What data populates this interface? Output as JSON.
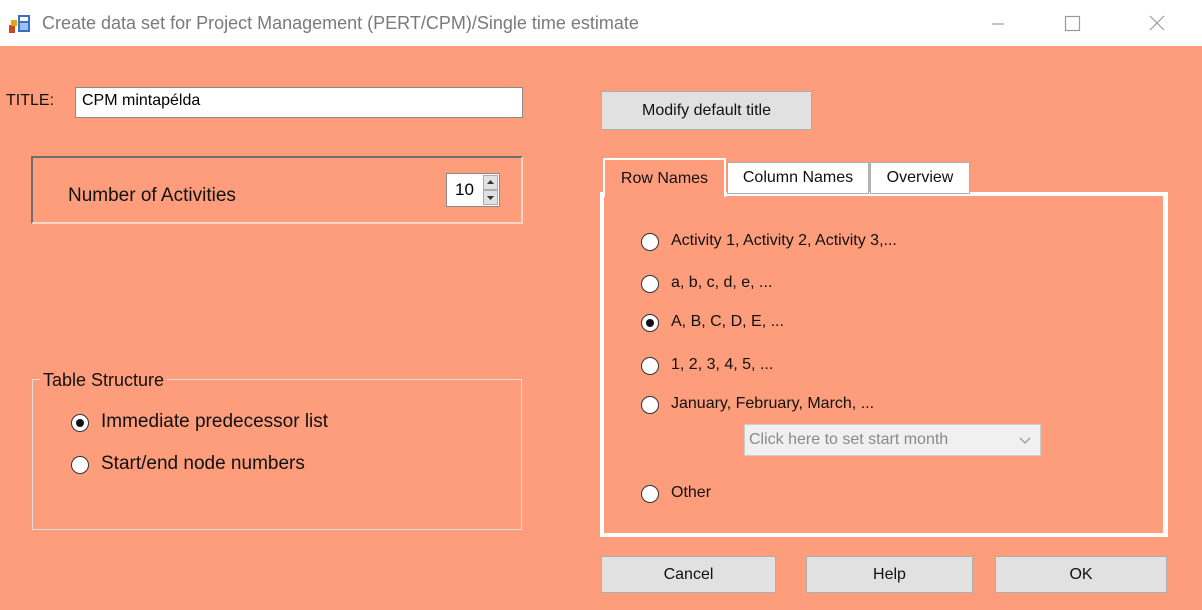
{
  "window": {
    "title": "Create data set for Project Management (PERT/CPM)/Single time estimate"
  },
  "title_field": {
    "label": "TITLE:",
    "value": "CPM mintapélda"
  },
  "modify_title_button": "Modify default title",
  "activities": {
    "label": "Number of Activities",
    "value": "10"
  },
  "table_structure": {
    "legend": "Table Structure",
    "options": [
      {
        "label": "Immediate predecessor list",
        "selected": true
      },
      {
        "label": "Start/end node numbers",
        "selected": false
      }
    ]
  },
  "tabs": [
    {
      "label": "Row Names",
      "active": true
    },
    {
      "label": "Column Names",
      "active": false
    },
    {
      "label": "Overview",
      "active": false
    }
  ],
  "row_names": {
    "options": [
      {
        "label": "Activity 1, Activity 2, Activity 3,...",
        "selected": false
      },
      {
        "label": "a, b, c, d, e, ...",
        "selected": false
      },
      {
        "label": "A, B, C, D, E, ...",
        "selected": true
      },
      {
        "label": "1, 2, 3, 4, 5, ...",
        "selected": false
      },
      {
        "label": "January, February, March, ...",
        "selected": false
      },
      {
        "label": "Other",
        "selected": false
      }
    ],
    "start_month_placeholder": "Click here to set start month"
  },
  "buttons": {
    "cancel": "Cancel",
    "help": "Help",
    "ok": "OK"
  },
  "colors": {
    "background": "#fe9d7b",
    "button": "#e1e1e1"
  }
}
